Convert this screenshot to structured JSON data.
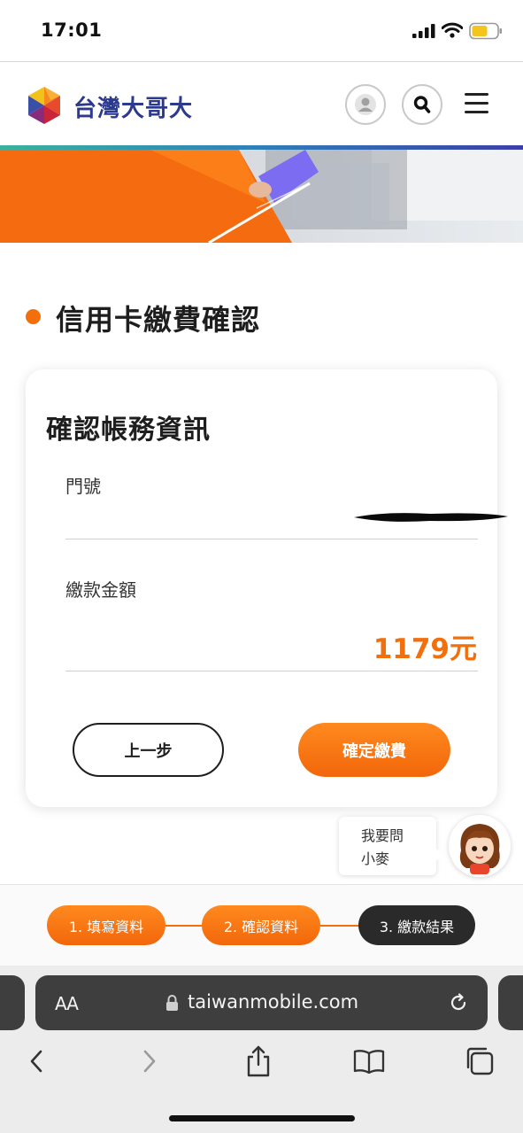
{
  "status_bar": {
    "time": "17:01"
  },
  "header": {
    "logo_text": "台灣大哥大"
  },
  "page": {
    "title": "信用卡繳費確認"
  },
  "card": {
    "title": "確認帳務資訊",
    "number_label": "門號",
    "amount_label": "繳款金額",
    "amount_value": "1179元",
    "prev_button": "上一步",
    "confirm_button": "確定繳費"
  },
  "chat": {
    "line1": "我要問",
    "line2": "小麥"
  },
  "steps": [
    {
      "label": "1. 填寫資料",
      "state": "done"
    },
    {
      "label": "2. 確認資料",
      "state": "current"
    },
    {
      "label": "3. 繳款結果",
      "state": "pending"
    }
  ],
  "browser": {
    "aa": "AA",
    "url": "taiwanmobile.com"
  },
  "colors": {
    "accent": "#f26f0c",
    "brand_blue": "#2b3a8c",
    "dark": "#2a2a2a"
  }
}
